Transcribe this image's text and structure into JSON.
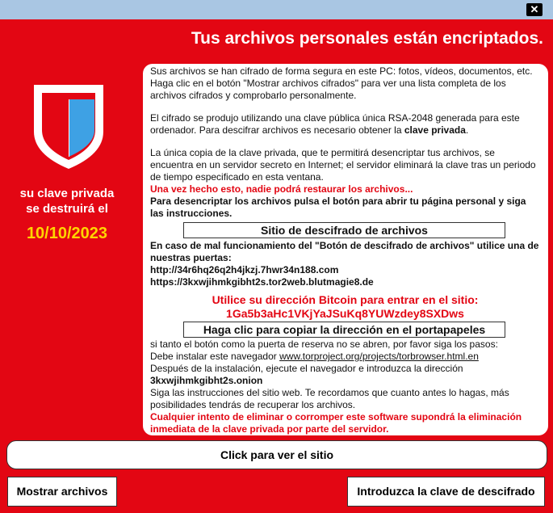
{
  "window": {
    "close_glyph": "✕"
  },
  "header": {
    "title": "Tus archivos personales están encriptados."
  },
  "left": {
    "line1": "su clave privada",
    "line2": "se destruirá el",
    "date": "10/10/2023",
    "shield_colors": {
      "outer": "#e30613",
      "inner_left": "#ffffff",
      "inner_right": "#3ea1e4"
    }
  },
  "panel": {
    "p1": "Sus archivos se han cifrado de forma segura en este PC: fotos, vídeos, documentos, etc. Haga clic en el botón \"Mostrar archivos cifrados\" para ver una lista completa de los archivos cifrados y comprobarlo personalmente.",
    "p2_a": "El cifrado se produjo utilizando una clave pública única RSA-2048 generada para este ordenador. Para descifrar archivos es necesario obtener la ",
    "p2_b": "clave privada",
    "p2_c": ".",
    "p3": "La única copia de la clave privada, que te permitirá desencriptar tus archivos, se encuentra en un servidor secreto en Internet; el servidor eliminará la clave tras un periodo de tiempo especificado en esta ventana.",
    "p3_warning": "Una vez hecho esto, nadie podrá restaurar los archivos...",
    "p4": "Para desencriptar los archivos pulsa el botón para abrir tu página personal y siga las instrucciones.",
    "site_button": "Sitio de descifrado de archivos",
    "p5": "En caso de mal funcionamiento del \"Botón de descifrado de archivos\" utilice una de nuestras puertas:",
    "gate1": "http://34r6hq26q2h4jkzj.7hwr34n188.com",
    "gate2": "https://3kxwjihmkgibht2s.tor2web.blutmagie8.de",
    "btc_label": "Utilice su dirección Bitcoin para entrar en el sitio:",
    "btc_address": "1Ga5b3aHc1VKjYaJSuKq8YUWzdey8SXDws",
    "copy_button": "Haga clic para copiar la dirección en el portapapeles",
    "p6": "si tanto el botón como la puerta de reserva no se abren, por favor siga los pasos:",
    "p7_a": "Debe instalar este navegador ",
    "p7_link": "www.torproject.org/projects/torbrowser.html.en",
    "p8": " Después de la instalación, ejecute el navegador e introduzca la dirección",
    "onion": "3kxwjihmkgibht2s.onion",
    "p9": "Siga las instrucciones del sitio web. Te recordamos que cuanto antes lo hagas, más posibilidades tendrás de recuperar los archivos.",
    "p10": " Cualquier intento de eliminar o corromper este software supondrá la eliminación inmediata de la clave privada por parte del servidor."
  },
  "buttons": {
    "view_site": "Click para ver el sitio",
    "show_files": "Mostrar archivos",
    "enter_key": "Introduzca la clave de descifrado"
  }
}
